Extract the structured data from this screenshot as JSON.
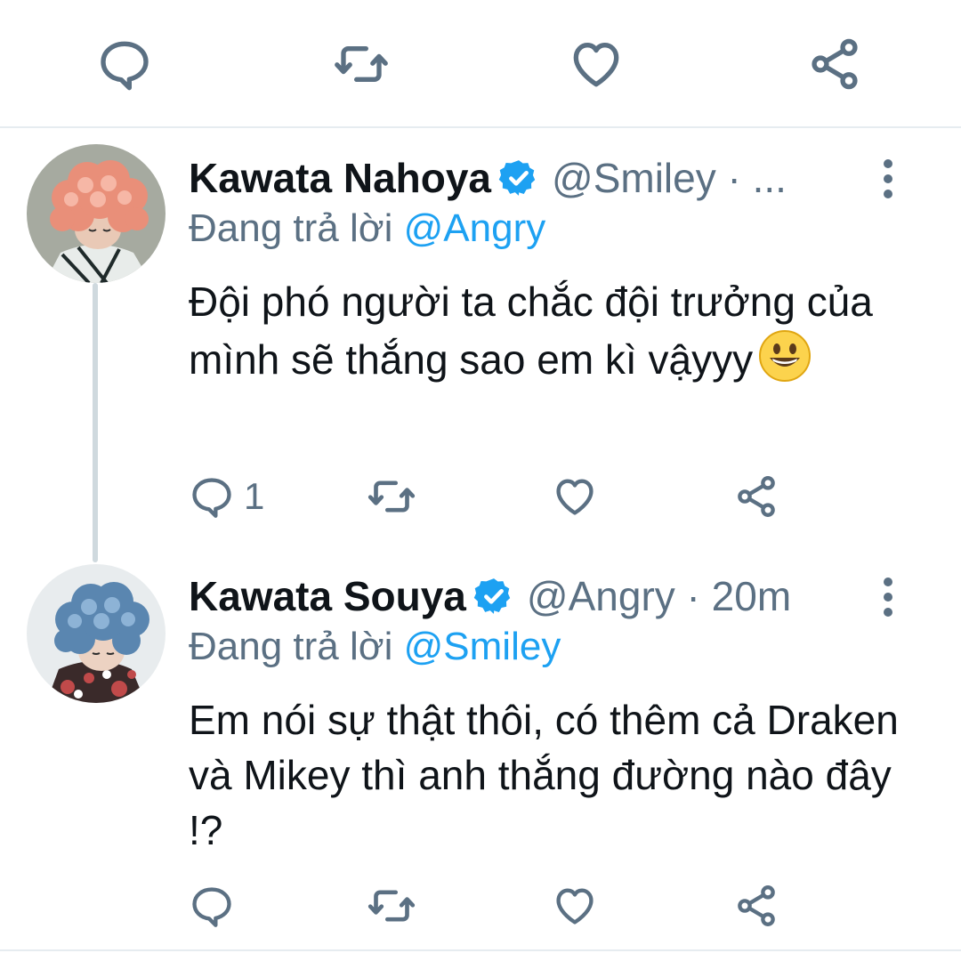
{
  "top_actions": {
    "reply": "reply-icon",
    "retweet": "retweet-icon",
    "like": "heart-icon",
    "share": "share-icon"
  },
  "tweets": [
    {
      "name": "Kawata Nahoya",
      "handle": "@Smiley · ...",
      "reply_prefix": "Đang trả lời",
      "reply_to": "@Angry",
      "text": "Đội phó người ta chắc đội trưởng của mình sẽ thắng sao em kì vậyyy",
      "emoji": "grinning-face-emoji",
      "reply_count": "1"
    },
    {
      "name": "Kawata Souya",
      "handle": "@Angry · 20m",
      "reply_prefix": "Đang trả lời",
      "reply_to": "@Smiley",
      "text": "Em nói sự thật thôi, có thêm cả Draken và Mikey thì anh thắng đường nào đây !?",
      "reply_count": ""
    }
  ],
  "colors": {
    "accent": "#1da1f2",
    "secondary_text": "#5b7083",
    "divider": "#e6ecf0",
    "thread_line": "#cfd9de"
  }
}
